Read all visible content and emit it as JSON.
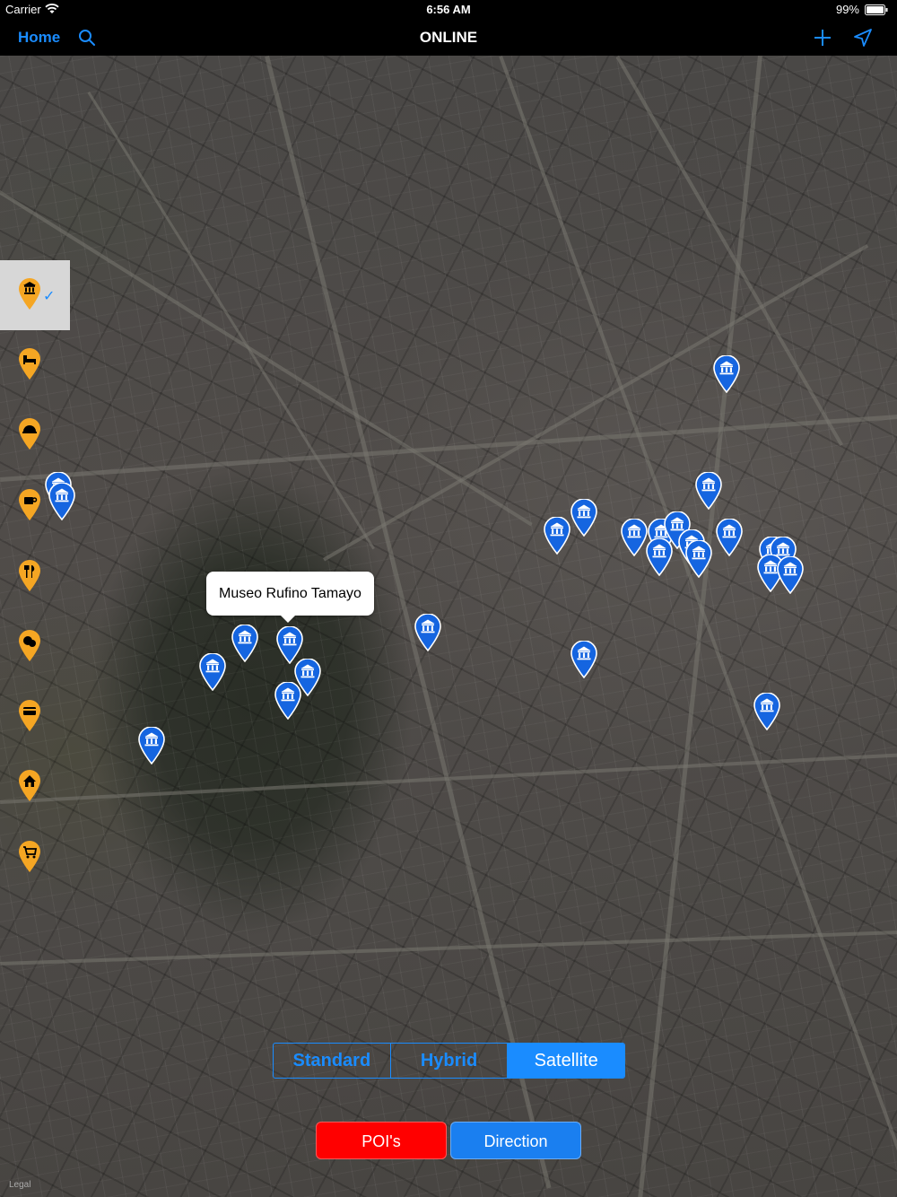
{
  "status_bar": {
    "carrier": "Carrier",
    "time": "6:56 AM",
    "battery": "99%"
  },
  "nav": {
    "home_label": "Home",
    "title": "ONLINE",
    "icons": [
      "search-icon",
      "plus-icon",
      "location-arrow-icon"
    ]
  },
  "colors": {
    "accent": "#1a8cff",
    "poi_button": "#ff0000",
    "direction_button": "#1a7ff0",
    "museum_pin": "#1565e0",
    "filter_pin": "#f5a623"
  },
  "filter_categories": [
    {
      "icon": "museum-icon",
      "selected": true
    },
    {
      "icon": "hotel-bed-icon",
      "selected": false
    },
    {
      "icon": "dish-icon",
      "selected": false
    },
    {
      "icon": "coffee-icon",
      "selected": false
    },
    {
      "icon": "restaurant-icon",
      "selected": false
    },
    {
      "icon": "theater-icon",
      "selected": false
    },
    {
      "icon": "atm-card-icon",
      "selected": false
    },
    {
      "icon": "home-icon",
      "selected": false
    },
    {
      "icon": "shopping-cart-icon",
      "selected": false
    }
  ],
  "callout": {
    "title": "Museo Rufino Tamayo"
  },
  "map_types": {
    "options": [
      "Standard",
      "Hybrid",
      "Satellite"
    ],
    "selected": "Satellite"
  },
  "buttons": {
    "pois": "POI's",
    "direction": "Direction"
  },
  "legal": "Legal"
}
